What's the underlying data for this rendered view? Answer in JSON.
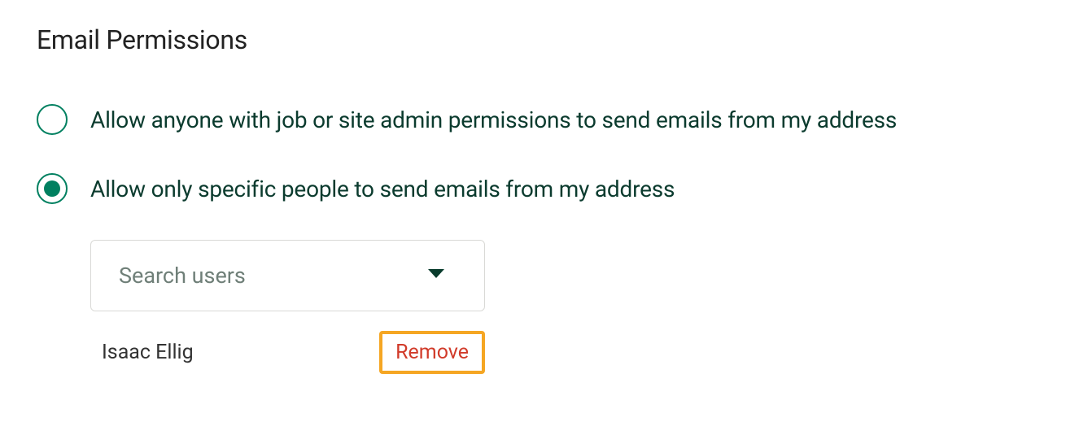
{
  "heading": "Email Permissions",
  "options": {
    "anyone": {
      "label": "Allow anyone with job or site admin permissions to send emails from my address",
      "selected": false
    },
    "specific": {
      "label": "Allow only specific people to send emails from my address",
      "selected": true
    }
  },
  "search": {
    "placeholder": "Search users"
  },
  "users": [
    {
      "name": "Isaac Ellig",
      "remove_label": "Remove"
    }
  ]
}
